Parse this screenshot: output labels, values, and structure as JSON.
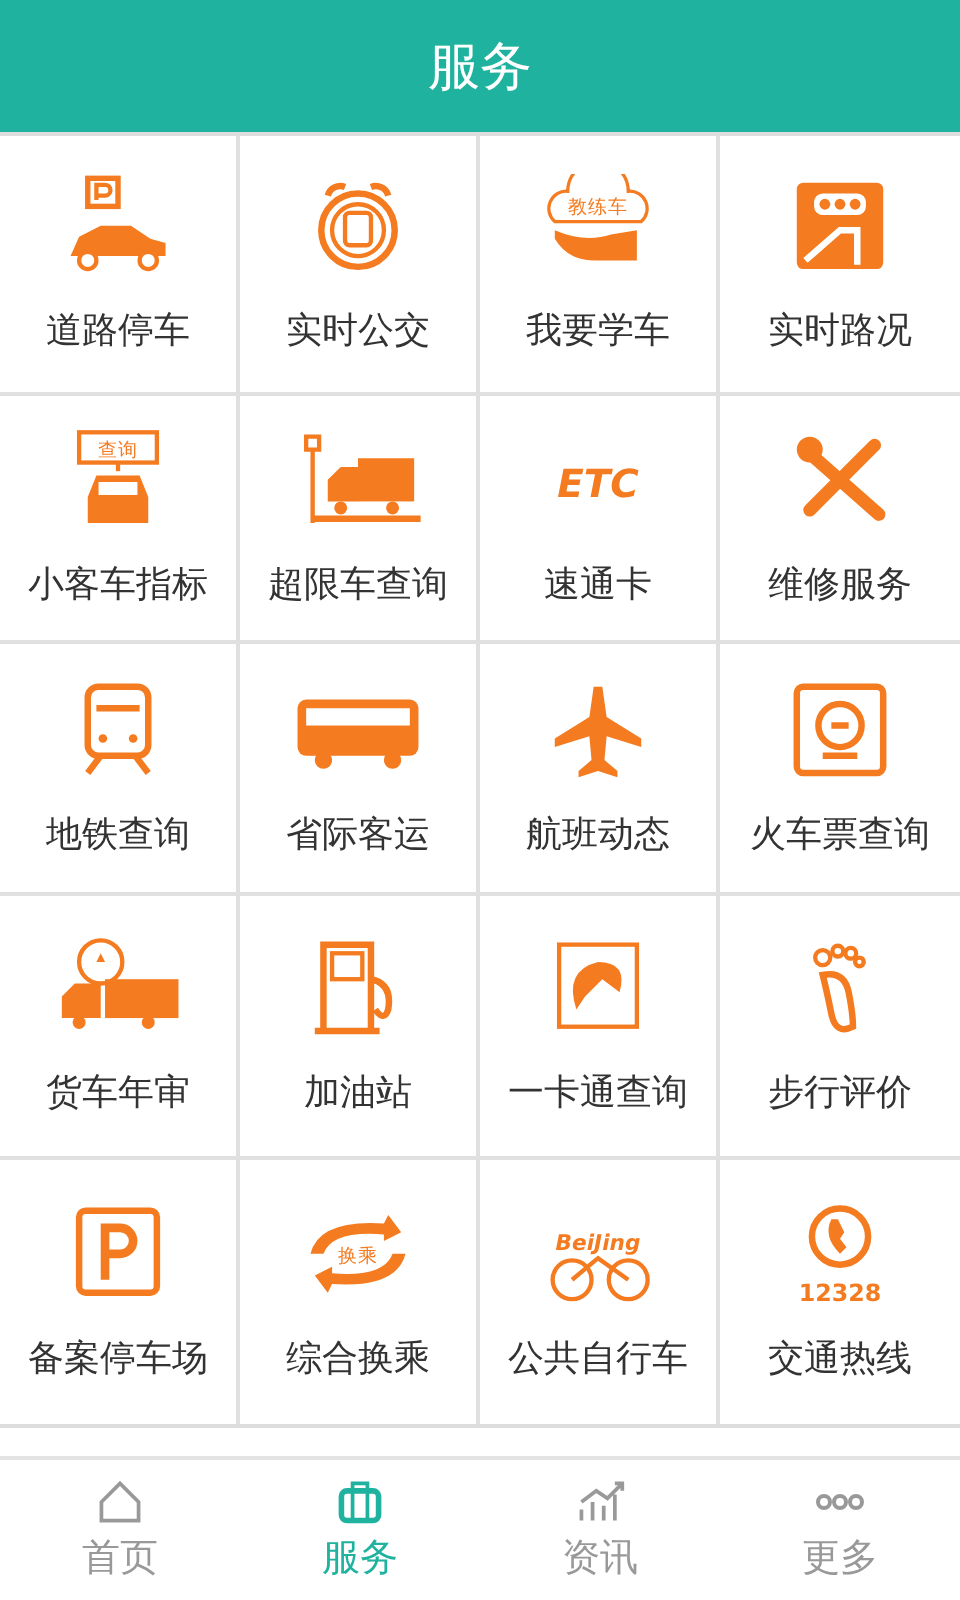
{
  "header": {
    "title": "服务"
  },
  "services": [
    {
      "label": "道路停车",
      "kind": "parking-car"
    },
    {
      "label": "实时公交",
      "kind": "bus-clock"
    },
    {
      "label": "我要学车",
      "kind": "learner-hand",
      "icon_text": "教练车"
    },
    {
      "label": "实时路况",
      "kind": "traffic-sign"
    },
    {
      "label": "小客车指标",
      "kind": "query-car",
      "icon_text": "查询"
    },
    {
      "label": "超限车查询",
      "kind": "truck-scale"
    },
    {
      "label": "速通卡",
      "kind": "etc",
      "icon_text": "ETC"
    },
    {
      "label": "维修服务",
      "kind": "tools"
    },
    {
      "label": "地铁查询",
      "kind": "subway"
    },
    {
      "label": "省际客运",
      "kind": "coach"
    },
    {
      "label": "航班动态",
      "kind": "plane"
    },
    {
      "label": "火车票查询",
      "kind": "train"
    },
    {
      "label": "货车年审",
      "kind": "truck-stamp"
    },
    {
      "label": "加油站",
      "kind": "fuel"
    },
    {
      "label": "一卡通查询",
      "kind": "card"
    },
    {
      "label": "步行评价",
      "kind": "foot"
    },
    {
      "label": "备案停车场",
      "kind": "parking"
    },
    {
      "label": "综合换乘",
      "kind": "transfer",
      "icon_text": "换乘"
    },
    {
      "label": "公共自行车",
      "kind": "bicycle",
      "icon_text": "BeiJing"
    },
    {
      "label": "交通热线",
      "kind": "phone",
      "icon_text": "12328"
    }
  ],
  "nav": [
    {
      "label": "首页",
      "kind": "home",
      "selected": false
    },
    {
      "label": "服务",
      "kind": "bag",
      "selected": true
    },
    {
      "label": "资讯",
      "kind": "chart",
      "selected": false
    },
    {
      "label": "更多",
      "kind": "dots",
      "selected": false
    }
  ]
}
